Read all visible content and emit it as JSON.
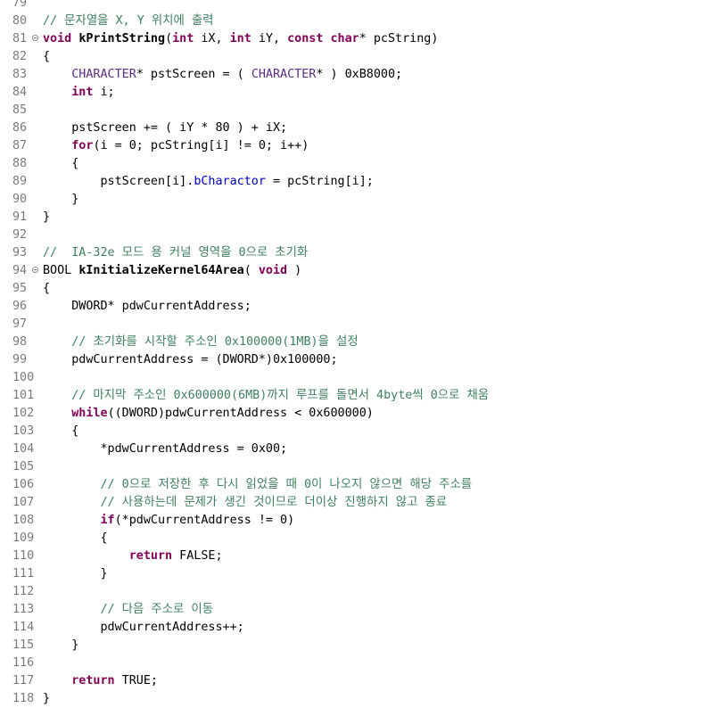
{
  "editor": {
    "lines": [
      {
        "num": "79",
        "fold": false,
        "tokens": []
      },
      {
        "num": "80",
        "fold": false,
        "tokens": [
          {
            "t": "cm",
            "s": "// 문자열을 X, Y 위치에 출력"
          }
        ]
      },
      {
        "num": "81",
        "fold": true,
        "tokens": [
          {
            "t": "kw",
            "s": "void"
          },
          {
            "t": "tx",
            "s": " "
          },
          {
            "t": "fn",
            "s": "kPrintString"
          },
          {
            "t": "tx",
            "s": "("
          },
          {
            "t": "kw",
            "s": "int"
          },
          {
            "t": "tx",
            "s": " iX, "
          },
          {
            "t": "kw",
            "s": "int"
          },
          {
            "t": "tx",
            "s": " iY, "
          },
          {
            "t": "kw",
            "s": "const"
          },
          {
            "t": "tx",
            "s": " "
          },
          {
            "t": "kw",
            "s": "char"
          },
          {
            "t": "tx",
            "s": "* pcString)"
          }
        ]
      },
      {
        "num": "82",
        "fold": false,
        "tokens": [
          {
            "t": "tx",
            "s": "{"
          }
        ]
      },
      {
        "num": "83",
        "fold": false,
        "tokens": [
          {
            "t": "tx",
            "s": "    "
          },
          {
            "t": "mc",
            "s": "CHARACTER"
          },
          {
            "t": "tx",
            "s": "* pstScreen = ( "
          },
          {
            "t": "mc",
            "s": "CHARACTER"
          },
          {
            "t": "tx",
            "s": "* ) 0xB8000;"
          }
        ]
      },
      {
        "num": "84",
        "fold": false,
        "tokens": [
          {
            "t": "tx",
            "s": "    "
          },
          {
            "t": "kw",
            "s": "int"
          },
          {
            "t": "tx",
            "s": " i;"
          }
        ]
      },
      {
        "num": "85",
        "fold": false,
        "tokens": []
      },
      {
        "num": "86",
        "fold": false,
        "tokens": [
          {
            "t": "tx",
            "s": "    pstScreen += ( iY * 80 ) + iX;"
          }
        ]
      },
      {
        "num": "87",
        "fold": false,
        "tokens": [
          {
            "t": "tx",
            "s": "    "
          },
          {
            "t": "kw",
            "s": "for"
          },
          {
            "t": "tx",
            "s": "(i = 0; pcString[i] != 0; i++)"
          }
        ]
      },
      {
        "num": "88",
        "fold": false,
        "tokens": [
          {
            "t": "tx",
            "s": "    {"
          }
        ]
      },
      {
        "num": "89",
        "fold": false,
        "tokens": [
          {
            "t": "tx",
            "s": "        pstScreen[i]."
          },
          {
            "t": "fd",
            "s": "bCharactor"
          },
          {
            "t": "tx",
            "s": " = pcString[i];"
          }
        ]
      },
      {
        "num": "90",
        "fold": false,
        "tokens": [
          {
            "t": "tx",
            "s": "    }"
          }
        ]
      },
      {
        "num": "91",
        "fold": false,
        "tokens": [
          {
            "t": "tx",
            "s": "}"
          }
        ]
      },
      {
        "num": "92",
        "fold": false,
        "tokens": []
      },
      {
        "num": "93",
        "fold": false,
        "tokens": [
          {
            "t": "cm",
            "s": "//  IA-32e 모드 용 커널 영역을 0으로 초기화"
          }
        ]
      },
      {
        "num": "94",
        "fold": true,
        "tokens": [
          {
            "t": "tx",
            "s": "BOOL "
          },
          {
            "t": "fn",
            "s": "kInitializeKernel64Area"
          },
          {
            "t": "tx",
            "s": "( "
          },
          {
            "t": "kw",
            "s": "void"
          },
          {
            "t": "tx",
            "s": " )"
          }
        ]
      },
      {
        "num": "95",
        "fold": false,
        "tokens": [
          {
            "t": "tx",
            "s": "{"
          }
        ]
      },
      {
        "num": "96",
        "fold": false,
        "tokens": [
          {
            "t": "tx",
            "s": "    DWORD* pdwCurrentAddress;"
          }
        ]
      },
      {
        "num": "97",
        "fold": false,
        "tokens": []
      },
      {
        "num": "98",
        "fold": false,
        "tokens": [
          {
            "t": "tx",
            "s": "    "
          },
          {
            "t": "cm",
            "s": "// 초기화를 시작할 주소인 0x100000(1MB)을 설정"
          }
        ]
      },
      {
        "num": "99",
        "fold": false,
        "tokens": [
          {
            "t": "tx",
            "s": "    pdwCurrentAddress = (DWORD*)0x100000;"
          }
        ]
      },
      {
        "num": "100",
        "fold": false,
        "tokens": []
      },
      {
        "num": "101",
        "fold": false,
        "tokens": [
          {
            "t": "tx",
            "s": "    "
          },
          {
            "t": "cm",
            "s": "// 마지막 주소인 0x600000(6MB)까지 루프를 돌면서 4byte씩 0으로 채움"
          }
        ]
      },
      {
        "num": "102",
        "fold": false,
        "tokens": [
          {
            "t": "tx",
            "s": "    "
          },
          {
            "t": "kw",
            "s": "while"
          },
          {
            "t": "tx",
            "s": "((DWORD)pdwCurrentAddress < 0x600000)"
          }
        ]
      },
      {
        "num": "103",
        "fold": false,
        "tokens": [
          {
            "t": "tx",
            "s": "    {"
          }
        ]
      },
      {
        "num": "104",
        "fold": false,
        "tokens": [
          {
            "t": "tx",
            "s": "        *pdwCurrentAddress = 0x00;"
          }
        ]
      },
      {
        "num": "105",
        "fold": false,
        "tokens": []
      },
      {
        "num": "106",
        "fold": false,
        "tokens": [
          {
            "t": "tx",
            "s": "        "
          },
          {
            "t": "cm",
            "s": "// 0으로 저장한 후 다시 읽었을 때 0이 나오지 않으면 해당 주소를"
          }
        ]
      },
      {
        "num": "107",
        "fold": false,
        "tokens": [
          {
            "t": "tx",
            "s": "        "
          },
          {
            "t": "cm",
            "s": "// 사용하는데 문제가 생긴 것이므로 더이상 진행하지 않고 종료"
          }
        ]
      },
      {
        "num": "108",
        "fold": false,
        "tokens": [
          {
            "t": "tx",
            "s": "        "
          },
          {
            "t": "kw",
            "s": "if"
          },
          {
            "t": "tx",
            "s": "(*pdwCurrentAddress != 0)"
          }
        ]
      },
      {
        "num": "109",
        "fold": false,
        "tokens": [
          {
            "t": "tx",
            "s": "        {"
          }
        ]
      },
      {
        "num": "110",
        "fold": false,
        "tokens": [
          {
            "t": "tx",
            "s": "            "
          },
          {
            "t": "kw",
            "s": "return"
          },
          {
            "t": "tx",
            "s": " FALSE;"
          }
        ]
      },
      {
        "num": "111",
        "fold": false,
        "tokens": [
          {
            "t": "tx",
            "s": "        }"
          }
        ]
      },
      {
        "num": "112",
        "fold": false,
        "tokens": []
      },
      {
        "num": "113",
        "fold": false,
        "tokens": [
          {
            "t": "tx",
            "s": "        "
          },
          {
            "t": "cm",
            "s": "// 다음 주소로 이동"
          }
        ]
      },
      {
        "num": "114",
        "fold": false,
        "tokens": [
          {
            "t": "tx",
            "s": "        pdwCurrentAddress++;"
          }
        ]
      },
      {
        "num": "115",
        "fold": false,
        "tokens": [
          {
            "t": "tx",
            "s": "    }"
          }
        ]
      },
      {
        "num": "116",
        "fold": false,
        "tokens": []
      },
      {
        "num": "117",
        "fold": false,
        "tokens": [
          {
            "t": "tx",
            "s": "    "
          },
          {
            "t": "kw",
            "s": "return"
          },
          {
            "t": "tx",
            "s": " TRUE;"
          }
        ]
      },
      {
        "num": "118",
        "fold": false,
        "tokens": [
          {
            "t": "tx",
            "s": "}"
          }
        ]
      }
    ]
  }
}
